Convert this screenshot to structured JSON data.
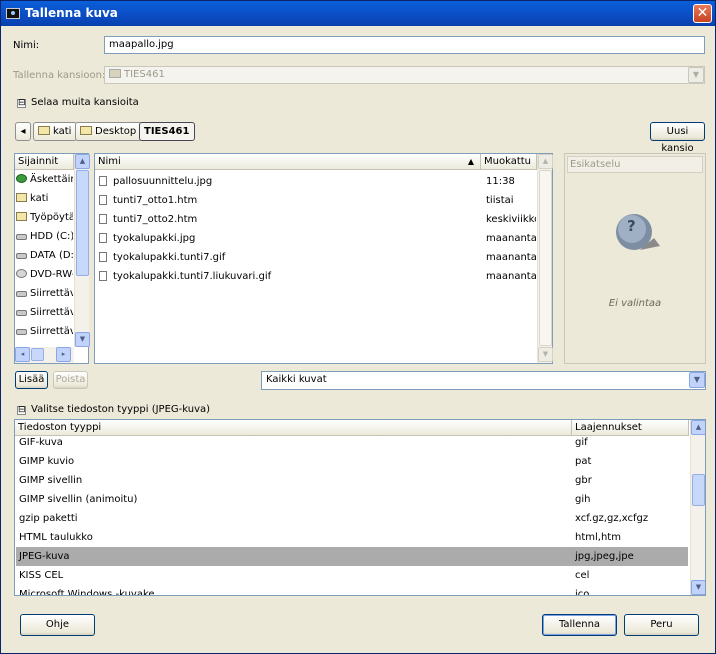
{
  "window": {
    "title": "Tallenna kuva",
    "close": "✕"
  },
  "name_field": {
    "label": "Nimi:",
    "value": "maapallo.jpg"
  },
  "save_in": {
    "label": "Tallenna kansioon:",
    "value": "TIES461"
  },
  "browse_toggle": {
    "expander": "⊟",
    "label": "Selaa muita kansioita"
  },
  "path_bar": {
    "back": "◂",
    "crumbs": [
      "kati",
      "Desktop",
      "TIES461"
    ],
    "new_folder": "Uusi kansio"
  },
  "places": {
    "header": "Sijainnit",
    "items": [
      {
        "label": "Äskettäin",
        "icon": "recent-icon"
      },
      {
        "label": "kati",
        "icon": "folder-icon"
      },
      {
        "label": "Työpöytä",
        "icon": "desktop-icon"
      },
      {
        "label": "HDD (C:)",
        "icon": "drive-icon"
      },
      {
        "label": "DATA (D:",
        "icon": "drive-icon"
      },
      {
        "label": "DVD-RW-",
        "icon": "cdrom-icon"
      },
      {
        "label": "Siirrettäv",
        "icon": "drive-icon"
      },
      {
        "label": "Siirrettäv",
        "icon": "drive-icon"
      },
      {
        "label": "Siirrettäv",
        "icon": "drive-icon"
      }
    ],
    "add": "Lisää",
    "remove": "Poista"
  },
  "files": {
    "col_name": "Nimi",
    "col_modified": "Muokattu",
    "sort_indicator": "▲",
    "rows": [
      {
        "name": "pallosuunnittelu.jpg",
        "modified": "11:38"
      },
      {
        "name": "tunti7_otto1.htm",
        "modified": "tiistai"
      },
      {
        "name": "tunti7_otto2.htm",
        "modified": "keskiviikko"
      },
      {
        "name": "tyokalupakki.jpg",
        "modified": "maanantai"
      },
      {
        "name": "tyokalupakki.tunti7.gif",
        "modified": "maanantai"
      },
      {
        "name": "tyokalupakki.tunti7.liukuvari.gif",
        "modified": "maanantai"
      }
    ]
  },
  "preview": {
    "header": "Esikatselu",
    "empty": "Ei valintaa",
    "icon_mark": "?"
  },
  "filter": {
    "value": "Kaikki kuvat"
  },
  "filetype": {
    "expander": "⊟",
    "label": "Valitse tiedoston tyyppi (JPEG-kuva)",
    "col_type": "Tiedoston tyyppi",
    "col_ext": "Laajennukset",
    "rows": [
      {
        "type": "GIF-kuva",
        "ext": "gif"
      },
      {
        "type": "GIMP kuvio",
        "ext": "pat"
      },
      {
        "type": "GIMP sivellin",
        "ext": "gbr"
      },
      {
        "type": "GIMP sivellin (animoitu)",
        "ext": "gih"
      },
      {
        "type": "gzip paketti",
        "ext": "xcf.gz,gz,xcfgz"
      },
      {
        "type": "HTML taulukko",
        "ext": "html,htm"
      },
      {
        "type": "JPEG-kuva",
        "ext": "jpg,jpeg,jpe",
        "selected": true
      },
      {
        "type": "KISS CEL",
        "ext": "cel"
      },
      {
        "type": "Microsoft Windows -kuvake",
        "ext": "ico"
      }
    ]
  },
  "buttons": {
    "help": "Ohje",
    "save": "Tallenna",
    "cancel": "Peru"
  },
  "scroll_glyphs": {
    "up": "▲",
    "down": "▼",
    "left": "◂",
    "right": "▸",
    "dropdown": "▼"
  }
}
